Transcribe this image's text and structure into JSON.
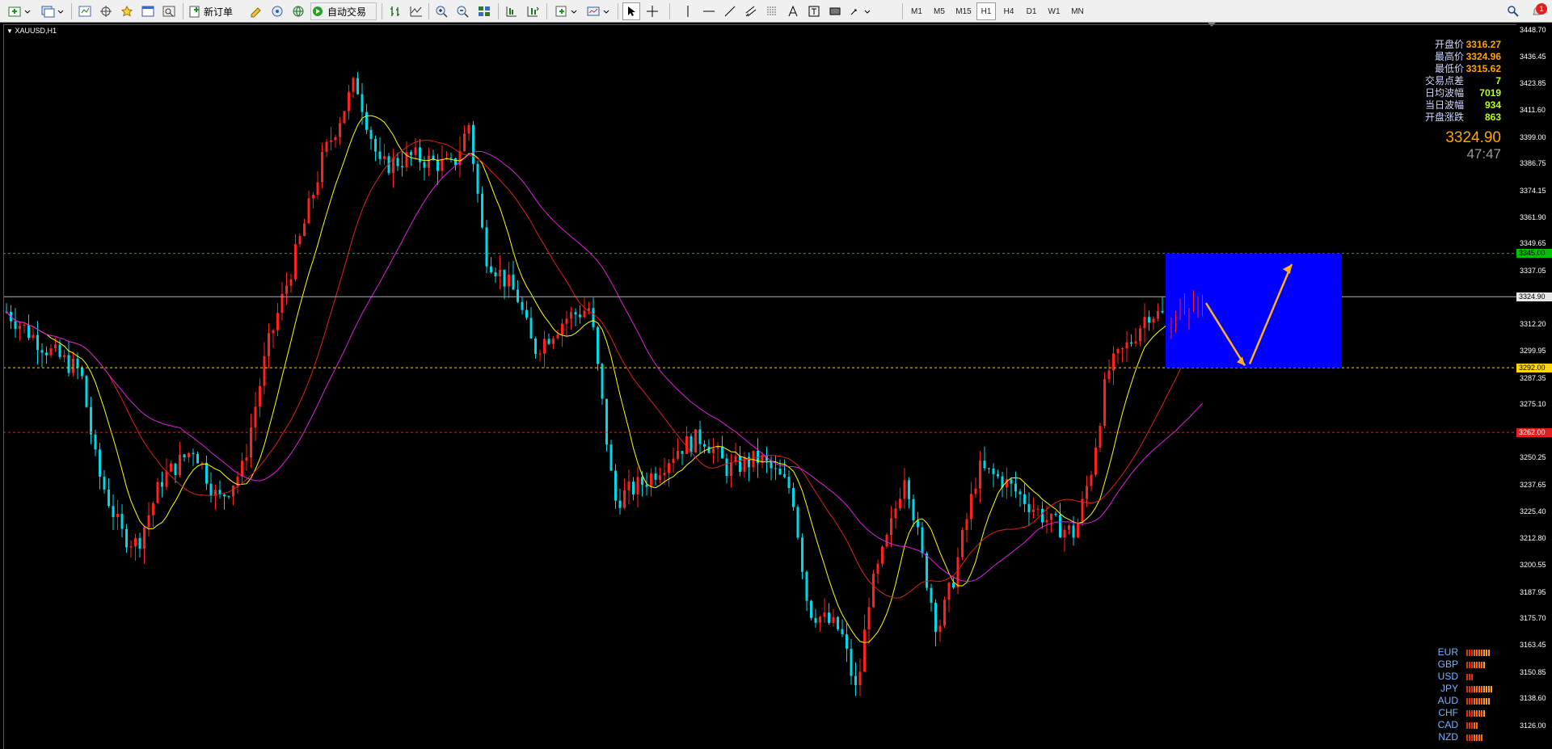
{
  "toolbar": {
    "new_order_label": "新订单",
    "auto_trade_label": "自动交易",
    "timeframes": [
      "M1",
      "M5",
      "M15",
      "H1",
      "H4",
      "D1",
      "W1",
      "MN"
    ],
    "active_timeframe": "H1",
    "notification_count": "1"
  },
  "chart": {
    "symbol_label": "XAUUSD,H1",
    "info_panel": [
      {
        "label": "开盘价",
        "value": "3316.27",
        "color": "orange"
      },
      {
        "label": "最高价",
        "value": "3324.96",
        "color": "orange"
      },
      {
        "label": "最低价",
        "value": "3315.62",
        "color": "orange"
      },
      {
        "label": "交易点差",
        "value": "7",
        "color": "green"
      },
      {
        "label": "日均波幅",
        "value": "7019",
        "color": "green"
      },
      {
        "label": "当日波幅",
        "value": "934",
        "color": "green"
      },
      {
        "label": "开盘涨跌",
        "value": "863",
        "color": "green"
      }
    ],
    "current_price": "3324.90",
    "candle_timer": "47:47",
    "price_axis": [
      "3448.70",
      "3436.45",
      "3423.85",
      "3411.60",
      "3399.00",
      "3386.75",
      "3374.15",
      "3361.90",
      "3349.65",
      "3337.05",
      "3324.80",
      "3312.20",
      "3299.95",
      "3287.35",
      "3275.10",
      "3262.50",
      "3250.25",
      "3237.65",
      "3225.40",
      "3212.80",
      "3200.55",
      "3187.95",
      "3175.70",
      "3163.45",
      "3150.85",
      "3138.60",
      "3126.00"
    ],
    "price_tags": {
      "resistance": "3345.00",
      "current": "3324.90",
      "support": "3292.00",
      "lower": "3262.00"
    },
    "currency_strength": [
      {
        "ccy": "EUR",
        "bars": 10
      },
      {
        "ccy": "GBP",
        "bars": 8
      },
      {
        "ccy": "USD",
        "bars": 3
      },
      {
        "ccy": "JPY",
        "bars": 11
      },
      {
        "ccy": "AUD",
        "bars": 10
      },
      {
        "ccy": "CHF",
        "bars": 8
      },
      {
        "ccy": "CAD",
        "bars": 5
      },
      {
        "ccy": "NZD",
        "bars": 7
      }
    ],
    "colors": {
      "bull": "#ff2020",
      "bear": "#00d8e8",
      "ma_fast": "#ffff00",
      "ma_mid": "#e02020",
      "ma_slow": "#e020e0",
      "zone": "#0000ff",
      "arrow": "#ffb020"
    }
  }
}
